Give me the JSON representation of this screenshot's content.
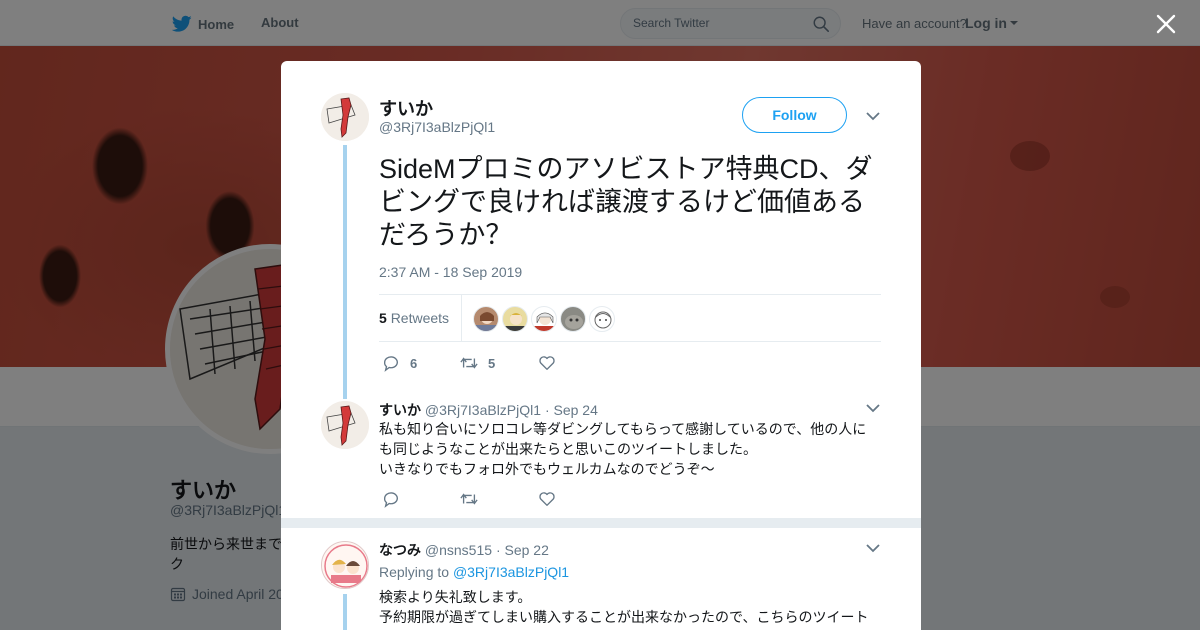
{
  "topbar": {
    "home_label": "Home",
    "about_label": "About",
    "search_placeholder": "Search Twitter",
    "account_prompt": "Have an account?",
    "login_label": "Log in"
  },
  "profile": {
    "name": "すいか",
    "handle": "@3Rj7I3aBlzPjQl1",
    "bio": "前世から来世まで ク",
    "joined": "Joined April 20"
  },
  "tweet": {
    "author_name": "すいか",
    "author_handle": "@3Rj7I3aBlzPjQl1",
    "follow_label": "Follow",
    "text": "SideMプロミのアソビストア特典CD、ダビングで良ければ譲渡するけど価値あるだろうか？",
    "timestamp": "2:37 AM - 18 Sep 2019",
    "retweet_count": "5",
    "retweets_label": "Retweets",
    "reply_count": "6",
    "rt_action_count": "5",
    "like_count": ""
  },
  "reply1": {
    "name": "すいか",
    "handle": "@3Rj7I3aBlzPjQl1",
    "date": "· Sep 24",
    "text": "私も知り合いにソロコレ等ダビングしてもらって感謝しているので、他の人にも同じようなことが出来たらと思いこのツイートしました。\nいきなりでもフォロ外でもウェルカムなのでどうぞ～"
  },
  "reply2": {
    "name": "なつみ",
    "handle": "@nsns515",
    "date": "· Sep 22",
    "replying_prefix": "Replying to",
    "replying_to": "@3Rj7I3aBlzPjQl1",
    "text": "検索より失礼致します。\n予約期限が過ぎてしまい購入することが出来なかったので、こちらのツイート"
  },
  "colors": {
    "accent": "#1da1f2",
    "thread_line": "#a6d2ee",
    "muted": "#657786"
  },
  "icons": [
    "twitter-bird-icon",
    "search-icon",
    "close-icon",
    "chevron-down-icon",
    "reply-icon",
    "retweet-icon",
    "like-icon",
    "calendar-icon"
  ]
}
